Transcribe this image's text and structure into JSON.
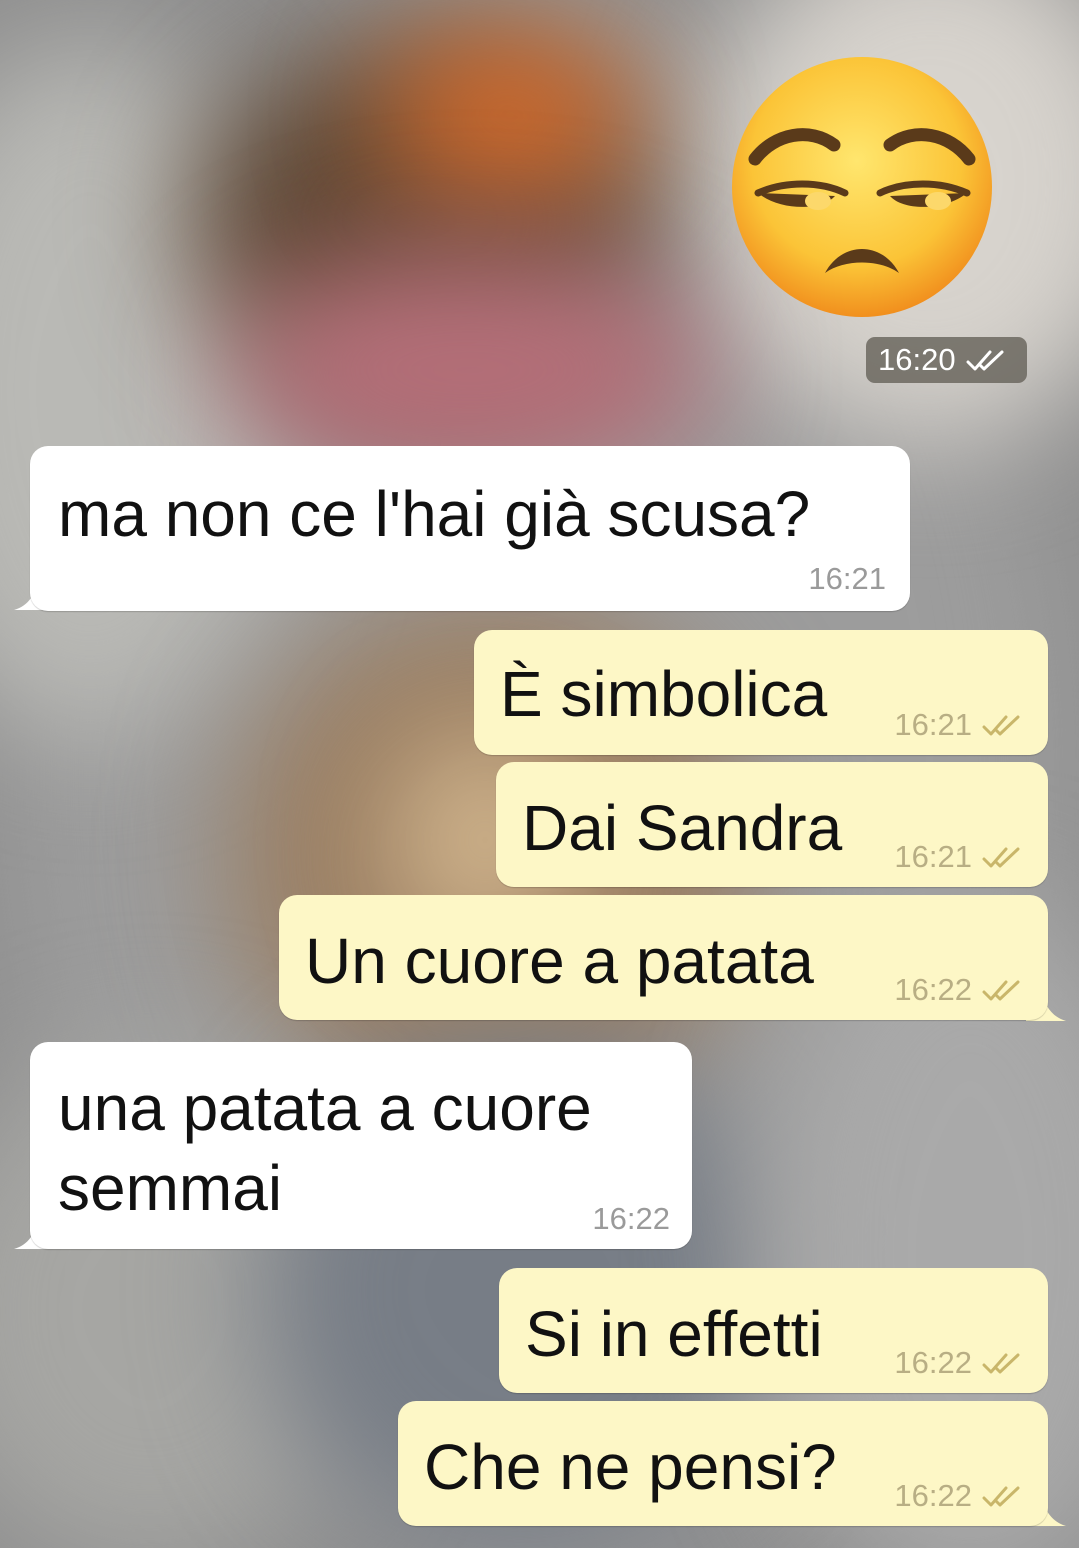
{
  "conversation": {
    "sticker": {
      "icon": "unamused-face-icon",
      "time": "16:20"
    },
    "messages": [
      {
        "direction": "incoming",
        "text": "ma non ce l'hai già scusa?",
        "time": "16:21"
      },
      {
        "direction": "outgoing",
        "text": "È simbolica",
        "time": "16:21",
        "status": "read"
      },
      {
        "direction": "outgoing",
        "text": "Dai Sandra",
        "time": "16:21",
        "status": "read"
      },
      {
        "direction": "outgoing",
        "text": "Un cuore a patata",
        "time": "16:22",
        "status": "read"
      },
      {
        "direction": "incoming",
        "text": "una patata a cuore semmai",
        "time": "16:22"
      },
      {
        "direction": "outgoing",
        "text": "Si in effetti",
        "time": "16:22",
        "status": "read"
      },
      {
        "direction": "outgoing",
        "text": "Che ne pensi?",
        "time": "16:22",
        "status": "read"
      }
    ]
  },
  "colors": {
    "incoming_bubble": "#ffffff",
    "outgoing_bubble": "#fdf7c6",
    "timestamp_pill": "#68645c"
  }
}
